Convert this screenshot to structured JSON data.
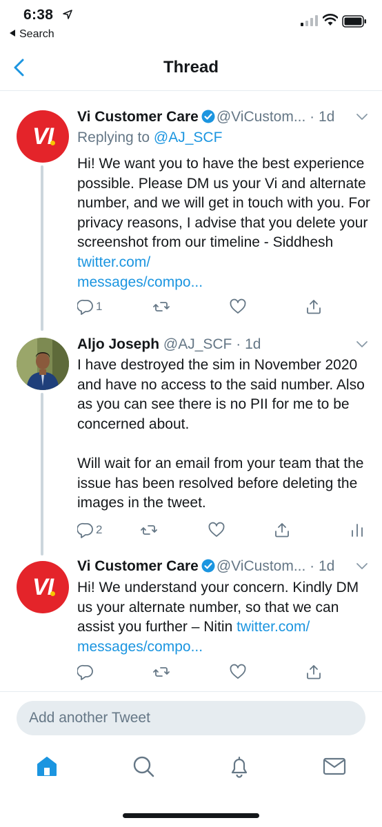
{
  "status_bar": {
    "time": "6:38",
    "back_app_label": "Search"
  },
  "nav": {
    "title": "Thread"
  },
  "tweets": [
    {
      "name": "Vi Customer Care",
      "handle": "@ViCustom...",
      "time": "1d",
      "verified": true,
      "replying_prefix": "Replying to",
      "replying_to": "@AJ_SCF",
      "text": "Hi! We want you to have the best experience possible. Please DM us your Vi and alternate number, and we will get in touch with you. For privacy reasons, I advise that you delete your screenshot from our timeline - Siddhesh ",
      "link": "twitter.com/messages/compo...",
      "link_line1": "twitter.com/",
      "link_line2": "messages/compo...",
      "reply_count": "1",
      "avatar_text": "VI"
    },
    {
      "name": "Aljo Joseph",
      "handle": "@AJ_SCF",
      "time": "1d",
      "verified": false,
      "text_p1": "I have destroyed the sim in November 2020 and have no access to the said number. Also as you can see there is no PII for me to be concerned about.",
      "text_p2": "Will wait for an email from your team that the issue has been resolved before deleting the images in the tweet.",
      "reply_count": "2"
    },
    {
      "name": "Vi Customer Care",
      "handle": "@ViCustom...",
      "time": "1d",
      "verified": true,
      "text": "Hi! We understand your concern. Kindly DM us your alternate number, so that we can assist you further – Nitin ",
      "link_line1": "twitter.com/",
      "link_line2": "messages/compo...",
      "avatar_text": "VI"
    }
  ],
  "compose": {
    "placeholder": "Add another Tweet"
  },
  "colors": {
    "accent": "#1b95e0",
    "vi_red": "#e4242a",
    "muted": "#657786",
    "divider": "#e6ecf0"
  },
  "tabs": [
    "home-icon",
    "search-icon",
    "notifications-icon",
    "messages-icon"
  ]
}
